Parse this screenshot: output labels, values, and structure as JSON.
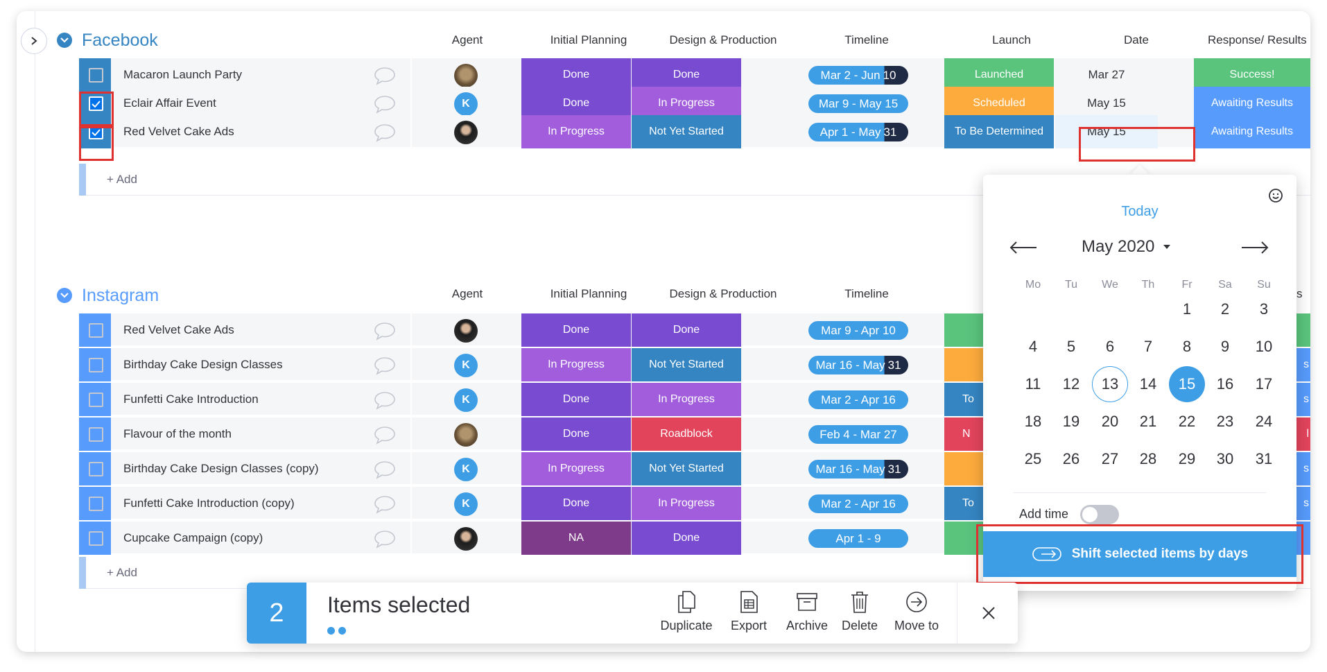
{
  "colors": {
    "done": "#784bd1",
    "in_progress": "#a25ddc",
    "not_yet_started": "#3585c2",
    "roadblock": "#e2445c",
    "na": "#7e3b8a",
    "launched": "#5ac47d",
    "scheduled": "#fdab3d",
    "to_be_determined": "#3585c2",
    "success": "#5ac47d",
    "awaiting": "#579bfc",
    "timeline_fill": "#3d9ee6",
    "timeline_dark": "#1f2a44",
    "accent": "#3d9ee6",
    "highlight": "#e03131"
  },
  "columns": {
    "agent": "Agent",
    "initial_planning": "Initial Planning",
    "design_production": "Design & Production",
    "timeline": "Timeline",
    "launch": "Launch",
    "date": "Date",
    "response_results": "Response/ Results",
    "response_results_clipped": "ults"
  },
  "groups": {
    "facebook": {
      "title": "Facebook",
      "add_label": "+ Add",
      "rows": [
        {
          "name": "Macaron Launch Party",
          "checked": false,
          "agent": "dog",
          "planning": "Done",
          "design": "Done",
          "timeline": "Mar 2 - Jun",
          "timeline_tail": "10",
          "launch": "Launched",
          "date": "Mar 27",
          "result": "Success!"
        },
        {
          "name": "Eclair Affair Event",
          "checked": true,
          "agent": "K",
          "planning": "Done",
          "design": "In Progress",
          "timeline": "Mar 9 - May 15",
          "timeline_tail": "",
          "launch": "Scheduled",
          "date": "May 15",
          "result": "Awaiting Results"
        },
        {
          "name": "Red Velvet Cake Ads",
          "checked": true,
          "agent": "woman",
          "planning": "In Progress",
          "design": "Not Yet Started",
          "timeline": "Apr 1 - May",
          "timeline_tail": "31",
          "launch": "To Be Determined",
          "date": "May 15",
          "result": "Awaiting Results"
        }
      ]
    },
    "instagram": {
      "title": "Instagram",
      "add_label": "+ Add",
      "rows": [
        {
          "name": "Red Velvet Cake Ads",
          "agent": "woman",
          "planning": "Done",
          "design": "Done",
          "timeline": "Mar 9 - Apr 10",
          "timeline_tail": "",
          "launch_partial": ""
        },
        {
          "name": "Birthday Cake Design Classes",
          "agent": "K",
          "planning": "In Progress",
          "design": "Not Yet Started",
          "timeline": "Mar 16 - May",
          "timeline_tail": "31",
          "launch_partial": ""
        },
        {
          "name": "Funfetti Cake Introduction",
          "agent": "K",
          "planning": "Done",
          "design": "In Progress",
          "timeline": "Mar 2 - Apr 16",
          "timeline_tail": "",
          "launch_partial": "To"
        },
        {
          "name": "Flavour of the month",
          "agent": "dog",
          "planning": "Done",
          "design": "Roadblock",
          "timeline": "Feb 4 - Mar 27",
          "timeline_tail": "",
          "launch_partial": "N"
        },
        {
          "name": "Birthday Cake Design Classes (copy)",
          "agent": "K",
          "planning": "In Progress",
          "design": "Not Yet Started",
          "timeline": "Mar 16 - May",
          "timeline_tail": "31",
          "launch_partial": ""
        },
        {
          "name": "Funfetti Cake Introduction (copy)",
          "agent": "K",
          "planning": "Done",
          "design": "In Progress",
          "timeline": "Mar 2 - Apr 16",
          "timeline_tail": "",
          "launch_partial": "To"
        },
        {
          "name": "Cupcake Campaign (copy)",
          "agent": "woman",
          "planning": "NA",
          "design": "Done",
          "timeline": "Apr 1 - 9",
          "timeline_tail": "",
          "launch_partial": ""
        }
      ],
      "results_clipped": [
        "",
        "s",
        "s",
        "l",
        "s",
        "s",
        ""
      ]
    }
  },
  "date_picker": {
    "today_label": "Today",
    "month_label": "May 2020",
    "weekdays": [
      "Mo",
      "Tu",
      "We",
      "Th",
      "Fr",
      "Sa",
      "Su"
    ],
    "days": [
      "1",
      "2",
      "3",
      "4",
      "5",
      "6",
      "7",
      "8",
      "9",
      "10",
      "11",
      "12",
      "13",
      "14",
      "15",
      "16",
      "17",
      "18",
      "19",
      "20",
      "21",
      "22",
      "23",
      "24",
      "25",
      "26",
      "27",
      "28",
      "29",
      "30",
      "31"
    ],
    "today_day": "13",
    "selected_day": "15",
    "add_time_label": "Add time",
    "add_time_enabled": false,
    "shift_button_label": "Shift selected items by days"
  },
  "action_bar": {
    "count": "2",
    "label": "Items selected",
    "actions": [
      {
        "label": "Duplicate",
        "icon": "duplicate-icon"
      },
      {
        "label": "Export",
        "icon": "export-icon"
      },
      {
        "label": "Archive",
        "icon": "archive-icon"
      },
      {
        "label": "Delete",
        "icon": "trash-icon"
      },
      {
        "label": "Move to",
        "icon": "move-to-icon"
      }
    ]
  }
}
